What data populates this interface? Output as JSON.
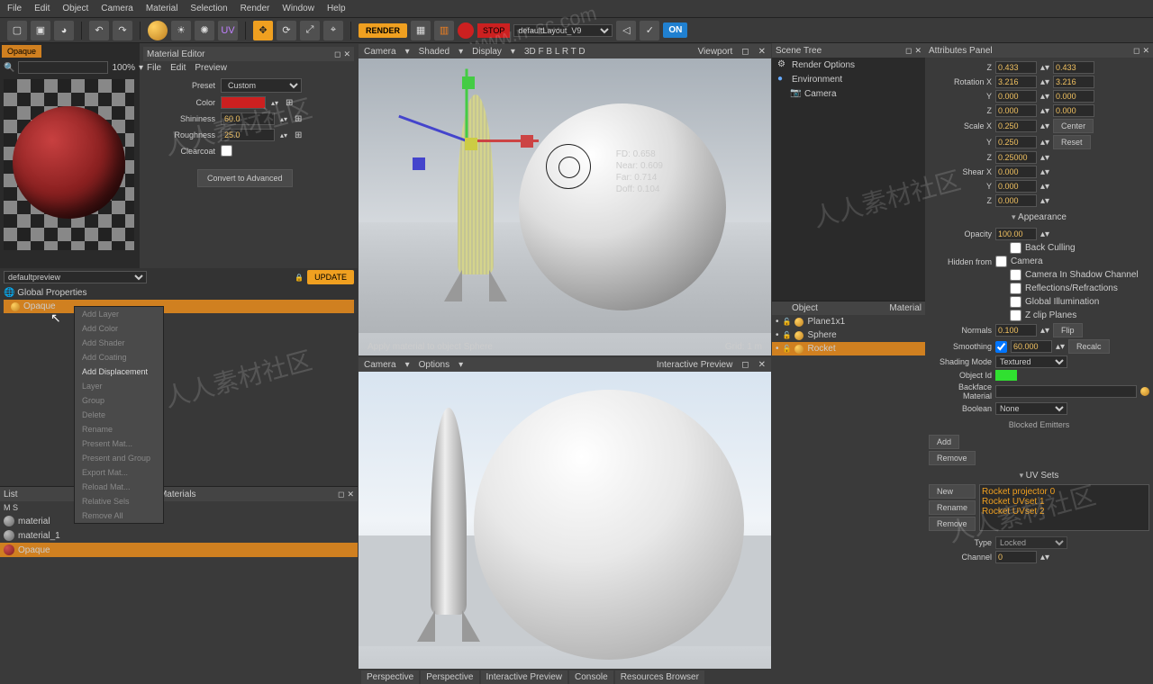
{
  "watermark_url": "www.rr-sc.com",
  "watermark_text": "人人素材社区",
  "menubar": [
    "File",
    "Edit",
    "Object",
    "Camera",
    "Material",
    "Selection",
    "Render",
    "Window",
    "Help"
  ],
  "toolbar": {
    "render": "RENDER",
    "stop": "STOP",
    "layout": "defaultLayout_V9",
    "on": "ON"
  },
  "mat_preview": {
    "tab": "Opaque",
    "zoom": "100%",
    "default_sel": "defaultpreview",
    "update": "UPDATE",
    "global": "Global Properties",
    "opaque": "Opaque"
  },
  "ctx_menu": {
    "items": [
      "Add Layer",
      "Add Color",
      "Add Shader",
      "Add Coating",
      "Add Displacement",
      "Layer",
      "Group",
      "Delete",
      "Rename",
      "Present Mat...",
      "Present and Group",
      "Export Mat...",
      "Reload Mat...",
      "Relative Sels",
      "Remove All"
    ],
    "active_idx": 4
  },
  "mat_editor": {
    "title": "Material Editor",
    "menu": [
      "File",
      "Edit",
      "Preview"
    ],
    "preset_label": "Preset",
    "preset": "Custom",
    "color": "Color",
    "shininess_label": "Shininess",
    "shininess": "60.0",
    "roughness_label": "Roughness",
    "roughness": "25.0",
    "clearcoat": "Clearcoat",
    "convert": "Convert to Advanced"
  },
  "list_panel": {
    "title": "List",
    "cols": "M   S",
    "mats_label": "Materials",
    "items": [
      {
        "name": "material"
      },
      {
        "name": "material_1"
      },
      {
        "name": "Opaque",
        "sel": true
      }
    ]
  },
  "viewport1": {
    "menu": [
      "Camera",
      "Shaded",
      "Display",
      "3D  F  B  L  R  T  D",
      "Viewport"
    ],
    "fd": "FD: 0.658",
    "near": "Near: 0.609",
    "far": "Far: 0.714",
    "dof": "Doff: 0.104",
    "status_left": "Apply material to object Sphere",
    "status_right": "Grid: 1 m"
  },
  "viewport2": {
    "menu": [
      "Camera",
      "Options"
    ],
    "title": "Interactive Preview"
  },
  "bot_tabs": [
    "Perspective",
    "Perspective",
    "Interactive Preview",
    "Console",
    "Resources Browser"
  ],
  "scene_tree": {
    "title": "Scene Tree",
    "rows": [
      {
        "n": "Render Options"
      },
      {
        "n": "Environment"
      },
      {
        "n": "Camera",
        "indent": 1
      }
    ]
  },
  "objects": {
    "hdr_obj": "Object",
    "hdr_mat": "Material",
    "rows": [
      {
        "n": "Plane1x1"
      },
      {
        "n": "Sphere"
      },
      {
        "n": "Rocket",
        "sel": true
      }
    ]
  },
  "attrib": {
    "title": "Attributes Panel",
    "z": "0.433",
    "z2": "0.433",
    "rotX": "3.216",
    "rotX2": "3.216",
    "rotY": "0.000",
    "rotY2": "0.000",
    "rotZ": "0.000",
    "rotZ2": "0.000",
    "scX": "0.250",
    "scY": "0.250",
    "scZ": "0.25000",
    "center": "Center",
    "reset": "Reset",
    "shX": "0.000",
    "shY": "0.000",
    "shZ": "0.000",
    "appearance": "Appearance",
    "opacity": "100.00",
    "backculling": "Back Culling",
    "hidden": "Hidden from",
    "camera": "Camera",
    "cam_shadow": "Camera In Shadow Channel",
    "refl": "Reflections/Refractions",
    "gi": "Global Illumination",
    "zclip": "Z clip Planes",
    "normals": "Normals",
    "normals_v": "0.100",
    "flip": "Flip",
    "smoothing": "Smoothing",
    "smoothing_v": "60.000",
    "recalc": "Recalc",
    "shading_mode": "Shading Mode",
    "shading_v": "Textured",
    "object_id": "Object Id",
    "backface": "Backface Material",
    "boolean": "Boolean",
    "boolean_v": "None",
    "blocked": "Blocked Emitters",
    "add": "Add",
    "remove": "Remove",
    "uvsets": "UV Sets",
    "new": "New",
    "rename": "Rename",
    "uv_items": [
      "Rocket projector 0",
      "Rocket UVset 1",
      "Rocket UVset 2"
    ],
    "type": "Type",
    "type_v": "Locked",
    "channel": "Channel",
    "channel_v": "0",
    "rotX_lbl": "Rotation X",
    "Y": "Y",
    "Z": "Z",
    "scX_lbl": "Scale X",
    "shX_lbl": "Shear X",
    "opacity_lbl": "Opacity"
  }
}
